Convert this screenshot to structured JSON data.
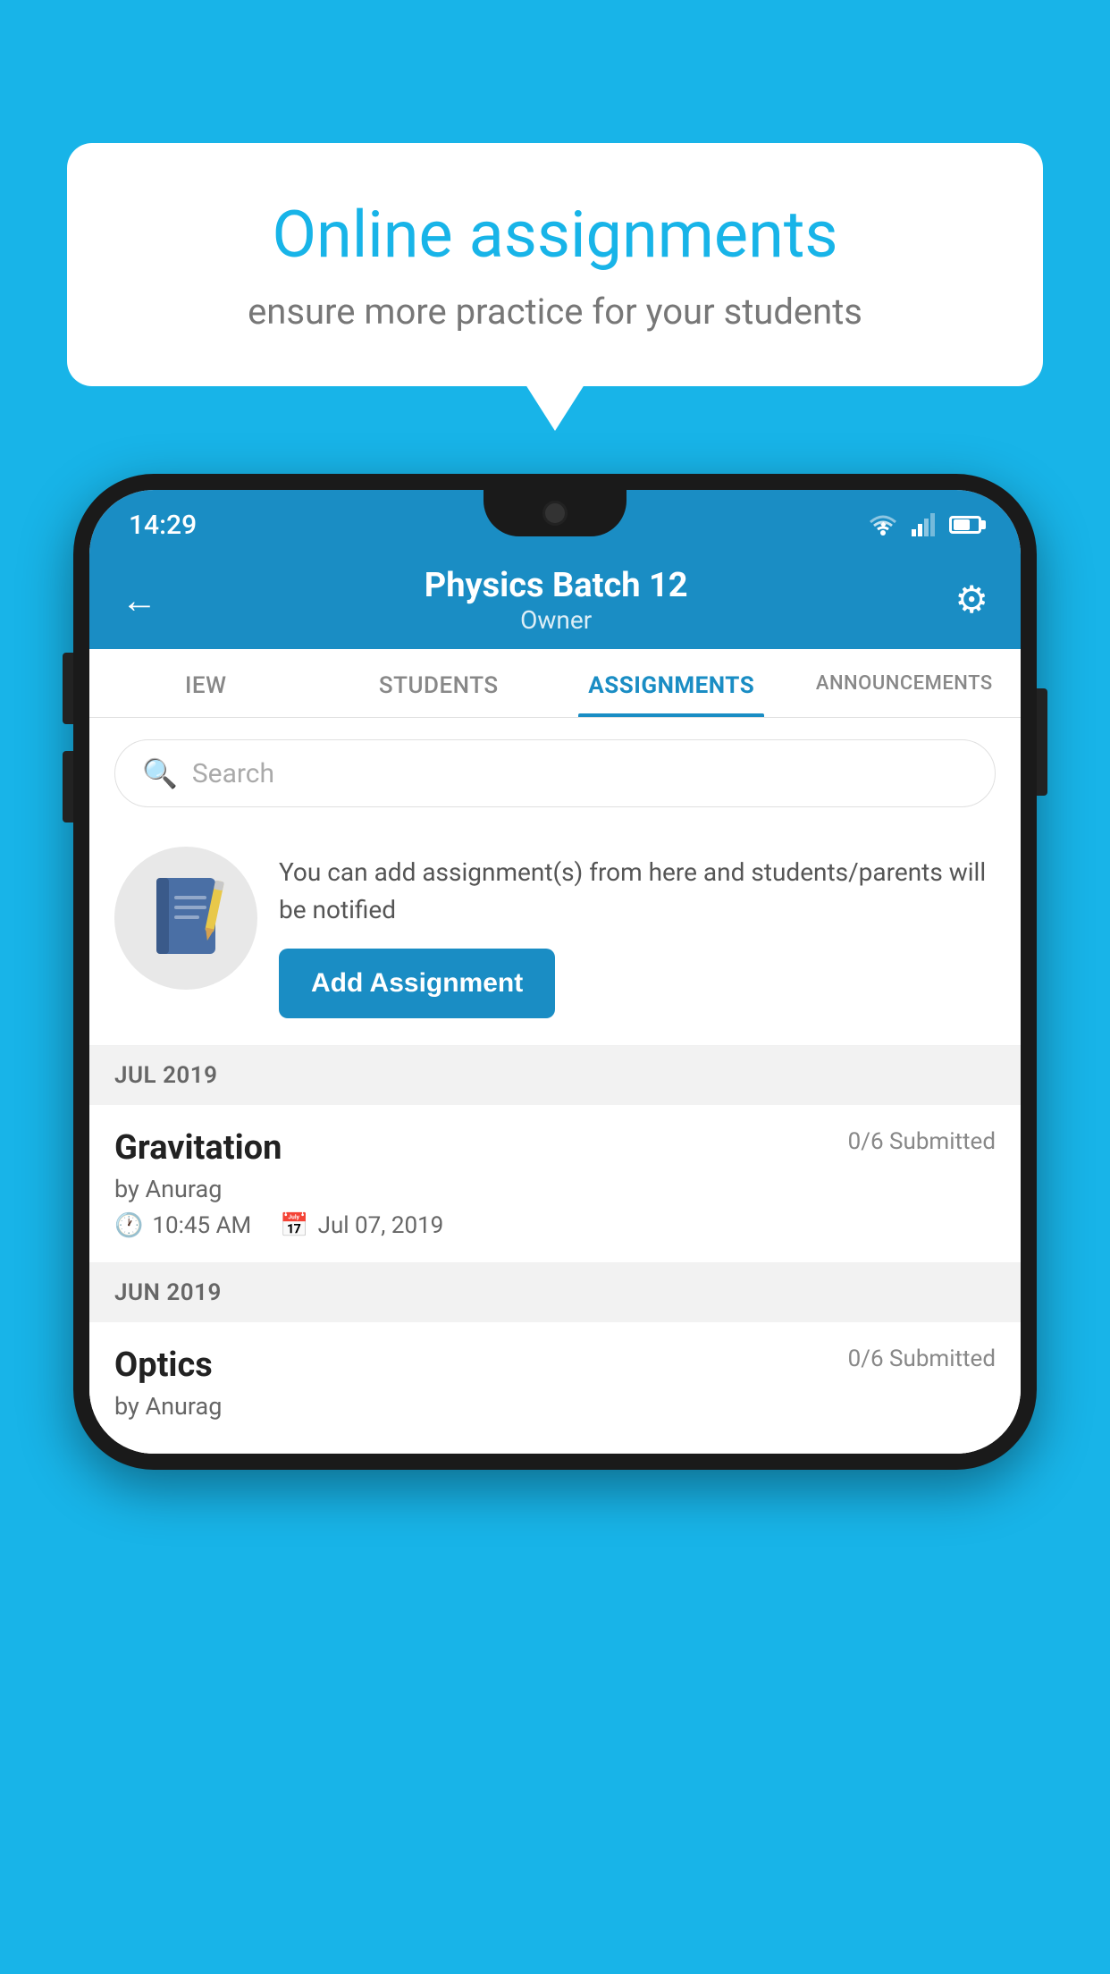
{
  "background_color": "#18b4e8",
  "speech_bubble": {
    "title": "Online assignments",
    "subtitle": "ensure more practice for your students"
  },
  "status_bar": {
    "time": "14:29",
    "wifi": "wifi",
    "signal": "signal",
    "battery": "battery"
  },
  "header": {
    "title": "Physics Batch 12",
    "subtitle": "Owner",
    "back_label": "←",
    "settings_label": "⚙"
  },
  "tabs": [
    {
      "label": "IEW",
      "active": false
    },
    {
      "label": "STUDENTS",
      "active": false
    },
    {
      "label": "ASSIGNMENTS",
      "active": true
    },
    {
      "label": "ANNOUNCEMENTS",
      "active": false
    }
  ],
  "search": {
    "placeholder": "Search"
  },
  "promo": {
    "text": "You can add assignment(s) from here and students/parents will be notified",
    "button_label": "Add Assignment"
  },
  "sections": [
    {
      "month": "JUL 2019",
      "assignments": [
        {
          "name": "Gravitation",
          "submitted": "0/6 Submitted",
          "by": "by Anurag",
          "time": "10:45 AM",
          "date": "Jul 07, 2019"
        }
      ]
    },
    {
      "month": "JUN 2019",
      "assignments": [
        {
          "name": "Optics",
          "submitted": "0/6 Submitted",
          "by": "by Anurag",
          "time": "",
          "date": ""
        }
      ]
    }
  ]
}
